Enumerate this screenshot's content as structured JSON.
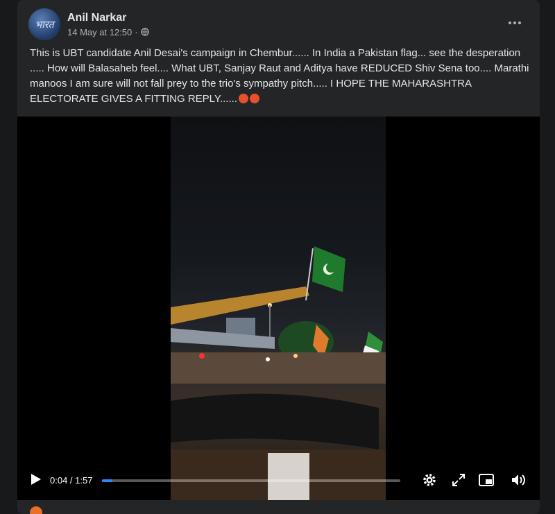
{
  "post": {
    "author": "Anil Narkar",
    "avatar_text": "भारत",
    "date": "14 May at 12:50",
    "separator": "·",
    "text": "This is UBT candidate Anil Desai's  campaign in Chembur......  In India a  Pakistan flag... see the desperation .....           How will Balasaheb feel.... What UBT, Sanjay Raut and Aditya have REDUCED Shiv Sena too.... Marathi manoos I am sure will not fall prey to the trio's sympathy pitch..... I HOPE THE MAHARASHTRA ELECTORATE GIVES A FITTING REPLY......"
  },
  "video": {
    "current_time": "0:04",
    "time_separator": " / ",
    "duration": "1:57",
    "progress_fraction": 0.034
  },
  "icons": {
    "privacy": "globe-icon",
    "more": "more-options-icon",
    "play": "play-icon",
    "settings": "gear-icon",
    "expand": "expand-icon",
    "pip": "picture-in-picture-icon",
    "volume": "volume-icon",
    "emoji": "angry-face-emoji"
  },
  "colors": {
    "card_bg": "#242526",
    "accent": "#2d88ff",
    "flag_green": "#1f7a2e"
  }
}
